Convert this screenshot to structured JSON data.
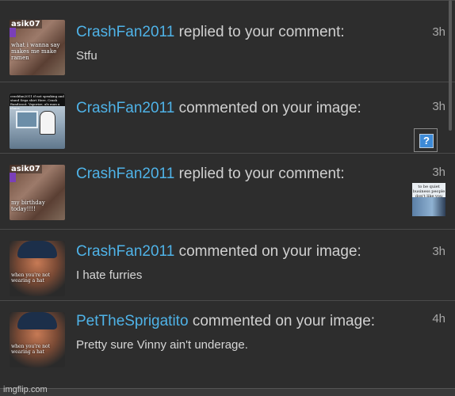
{
  "notifications": [
    {
      "user": "CrashFan2011",
      "action": "replied to your comment:",
      "body": "Stfu",
      "time": "3h",
      "thumb": {
        "tag": "asik07",
        "caption": "what i wanna say makes me make ramen"
      }
    },
    {
      "user": "CrashFan2011",
      "action": "commented on your image:",
      "body": "",
      "time": "3h",
      "attachment": "?",
      "thumb": {
        "header": "crashfan2011 if not speaking and stand Sega shirt Here. Crash Bandicoot. Vaporize, als man a chaos"
      }
    },
    {
      "user": "CrashFan2011",
      "action": "replied to your comment:",
      "body": "",
      "time": "3h",
      "preview": {
        "caption": "to be quiet business people don't like you"
      },
      "thumb": {
        "tag": "asik07",
        "caption": "my birthday today!!!!"
      }
    },
    {
      "user": "CrashFan2011",
      "action": "commented on your image:",
      "body": "I hate furries",
      "time": "3h",
      "thumb": {
        "caption": "when you're not wearing a hat"
      }
    },
    {
      "user": "PetTheSprigatito",
      "action": "commented on your image:",
      "body": "Pretty sure Vinny ain't underage.",
      "time": "4h",
      "thumb": {
        "caption": "when you're not wearing a hat"
      }
    }
  ],
  "watermark": "imgflip.com",
  "colors": {
    "username": "#4fb3e8",
    "background": "#2d2d2d",
    "text": "#d0d0d0"
  }
}
